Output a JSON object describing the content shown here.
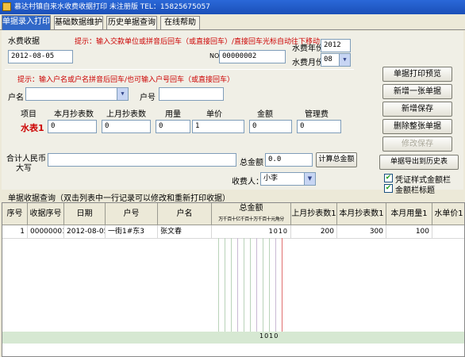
{
  "window": {
    "title": "慕达村镇自来水收费收据打印  未注册版  TEL：15825675057"
  },
  "tabs": [
    {
      "label": "单据录入打印",
      "active": true
    },
    {
      "label": "基础数据维护",
      "active": false
    },
    {
      "label": "历史单据查询",
      "active": false
    },
    {
      "label": "在线帮助",
      "active": false
    }
  ],
  "form": {
    "section_label": "水费收据",
    "hint_top": "提示：输入交款单位或拼音后回车（或直接回车）/直接回车光标自动往下移动",
    "date_value": "2012-08-05",
    "no_label": "NO",
    "no_value": "00000002",
    "year_label": "水费年份",
    "year_value": "2012",
    "month_label": "水费月份",
    "month_value": "08",
    "hint_mid": "提示：输入户名或户名拼音后回车/也可输入户号回车（或直接回车）",
    "huming_label": "户名",
    "huhao_label": "户号",
    "col_headers": [
      "项目",
      "本月抄表数",
      "上月抄表数",
      "用量",
      "单价",
      "金额",
      "管理费"
    ],
    "row_label": "水表1",
    "row_values": [
      "0",
      "0",
      "0",
      "1",
      "0",
      "0"
    ],
    "rmb_label_1": "合计人民币",
    "rmb_label_2": "大写",
    "total_label": "总金额",
    "total_value": "0.0",
    "calc_button": "计算总金额",
    "collector_label": "收费人：",
    "collector_value": "小李"
  },
  "side_buttons": {
    "preview": "单据打印预览",
    "add_new": "新增一张单据",
    "save_new": "新增保存",
    "delete_all": "删除整张单据",
    "edit_save": "修改保存",
    "export_history": "单据导出到历史表"
  },
  "checkboxes": [
    {
      "label": "凭证样式金额栏",
      "checked": true
    },
    {
      "label": "金额栏标题",
      "checked": true
    }
  ],
  "grid": {
    "title": "单据收据查询（双击列表中一行记录可以修改和重新打印收据）",
    "headers": [
      "序号",
      "收据序号",
      "日期",
      "户号",
      "户名",
      "总金额",
      "上月抄表数1",
      "本月抄表数1",
      "本月用量1",
      "水单价1"
    ],
    "amount_digits": "万千百十亿千百十万千百十元角分",
    "rows": [
      {
        "seq": "1",
        "receipt_no": "00000001",
        "date": "2012-08-05",
        "huhao": "一街1#东3",
        "huming": "张文春",
        "amount": "1010",
        "prev_reading": "200",
        "cur_reading": "300",
        "usage": "100",
        "price": ""
      }
    ],
    "total_amount": "1010"
  },
  "colors": {
    "accent": "#3168c8",
    "hint": "#cc0000",
    "title_red": "#cc0000"
  },
  "icons": [
    "app-icon",
    "chevron-down-icon",
    "check-icon"
  ]
}
